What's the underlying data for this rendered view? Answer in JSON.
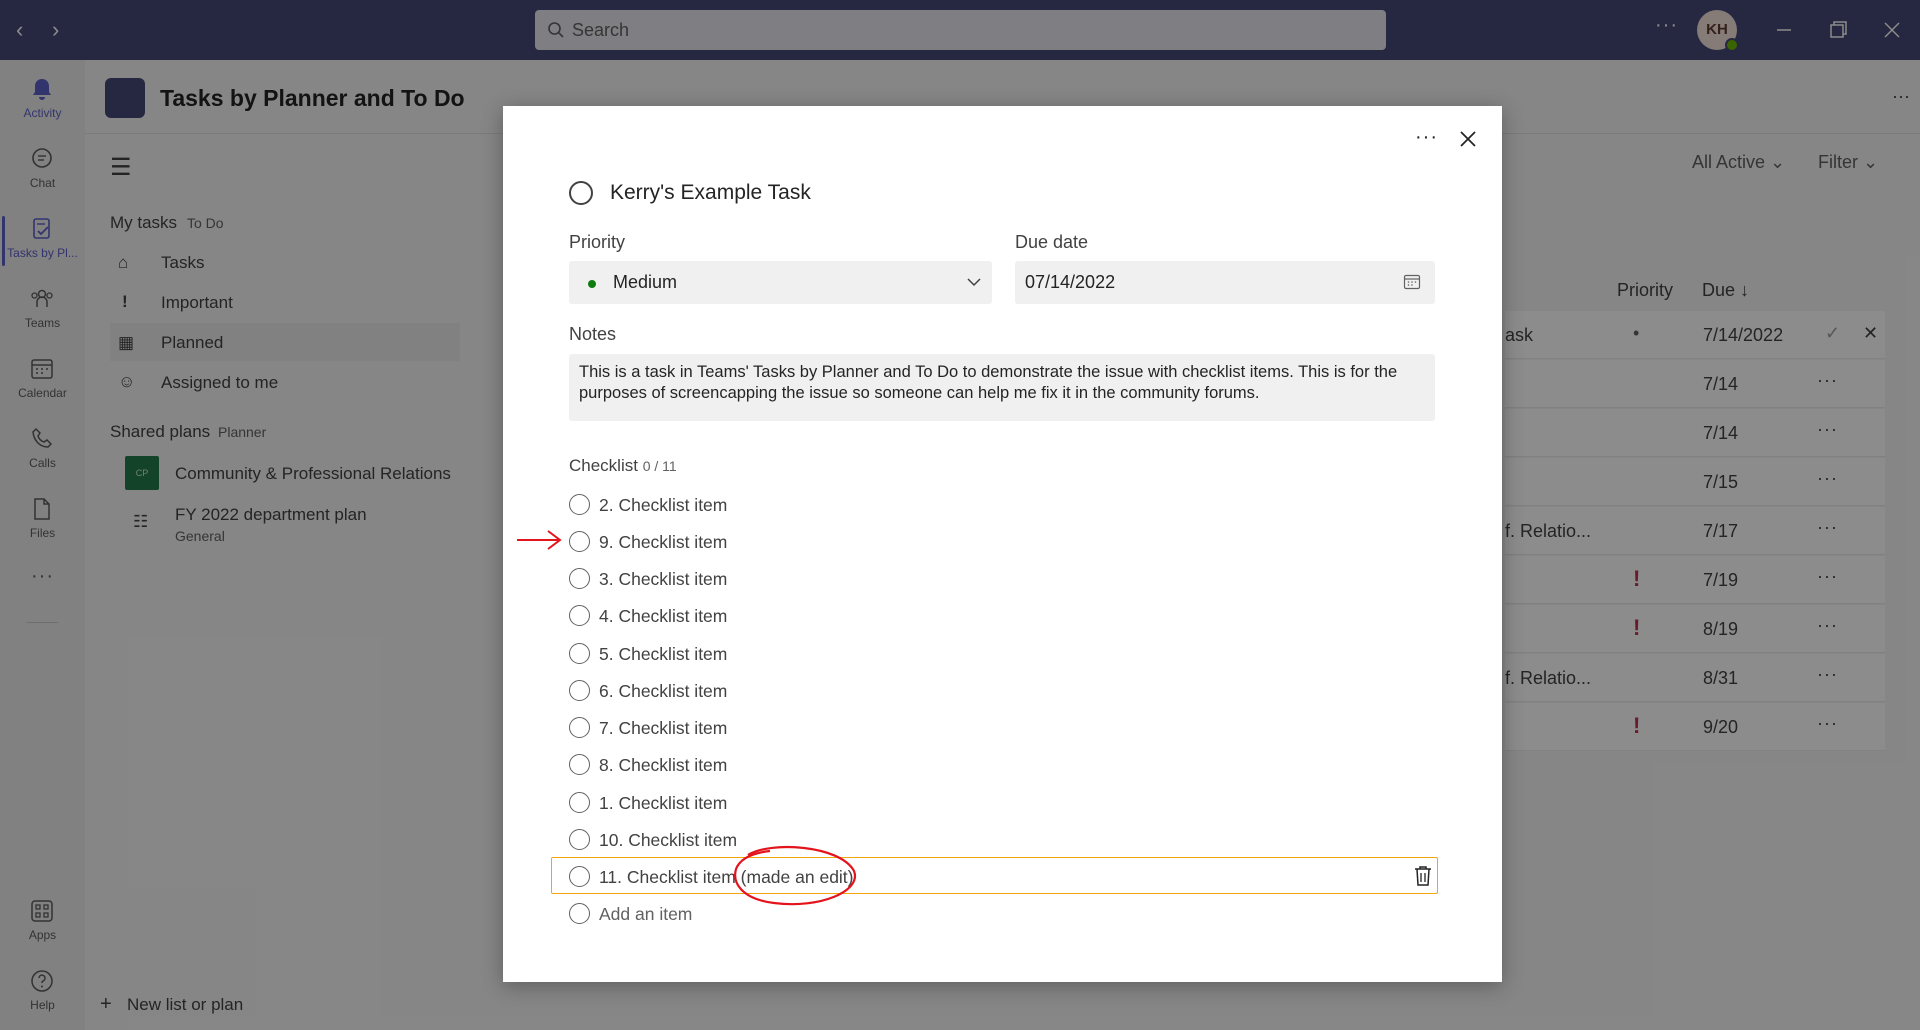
{
  "titlebar": {
    "back": "‹",
    "forward": "›",
    "search_placeholder": "Search",
    "more": "···",
    "avatar_initials": "KH"
  },
  "rail": {
    "items": [
      {
        "label": "Activity",
        "icon": "bell-icon"
      },
      {
        "label": "Chat",
        "icon": "chat-icon"
      },
      {
        "label": "Tasks by Pl...",
        "icon": "tasks-icon"
      },
      {
        "label": "Teams",
        "icon": "teams-icon"
      },
      {
        "label": "Calendar",
        "icon": "calendar-icon"
      },
      {
        "label": "Calls",
        "icon": "phone-icon"
      },
      {
        "label": "Files",
        "icon": "file-icon"
      },
      {
        "label": "Apps",
        "icon": "apps-icon"
      },
      {
        "label": "Help",
        "icon": "help-icon"
      }
    ],
    "more": "···"
  },
  "app": {
    "title": "Tasks by Planner and To Do",
    "more": "···",
    "my_tasks": "My tasks",
    "my_tasks_sub": "To Do",
    "nav": [
      "Tasks",
      "Important",
      "Planned",
      "Assigned to me"
    ],
    "shared_plans": "Shared plans",
    "shared_plans_sub": "Planner",
    "plans": [
      {
        "badge": "CP",
        "name": "Community & Professional Relations"
      },
      {
        "name": "FY 2022 department plan",
        "sub": "General"
      }
    ],
    "new_list": "New list or plan",
    "filter_all_active": "All Active",
    "filter": "Filter",
    "columns": {
      "priority": "Priority",
      "due": "Due ↓"
    },
    "rows": [
      {
        "text": "ask",
        "priority": "•",
        "due": "7/14/2022"
      },
      {
        "text": "",
        "due": "7/14"
      },
      {
        "text": "",
        "due": "7/14"
      },
      {
        "text": "",
        "due": "7/15"
      },
      {
        "text": "f. Relatio...",
        "due": "7/17"
      },
      {
        "text": "",
        "priority": "!",
        "due": "7/19"
      },
      {
        "text": "",
        "priority": "!",
        "due": "8/19"
      },
      {
        "text": "f. Relatio...",
        "due": "8/31"
      },
      {
        "text": "",
        "priority": "!",
        "due": "9/20"
      }
    ]
  },
  "dialog": {
    "more": "···",
    "task_title": "Kerry's Example Task",
    "priority_label": "Priority",
    "priority_value": "Medium",
    "due_label": "Due date",
    "due_value": "07/14/2022",
    "notes_label": "Notes",
    "notes_value": "This is a task in Teams' Tasks by Planner and To Do to demonstrate the issue with checklist items. This is for the purposes of screencapping the issue so someone can help me fix it in the community forums.",
    "checklist_label": "Checklist",
    "checklist_count": "0 / 11",
    "checklist": [
      "2. Checklist item",
      "9. Checklist item",
      "3. Checklist item",
      "4. Checklist item",
      "5. Checklist item",
      "6. Checklist item",
      "7. Checklist item",
      "8. Checklist item",
      "1. Checklist item",
      "10. Checklist item",
      "11. Checklist item (made an edit)"
    ],
    "add_item": "Add an item"
  },
  "colors": {
    "titlebar": "#464775",
    "accent": "#5b5fc7",
    "edit_border": "#f2a60e",
    "annotation": "#e3141c",
    "priority_medium": "#107c10",
    "priority_important": "#c4314b"
  }
}
